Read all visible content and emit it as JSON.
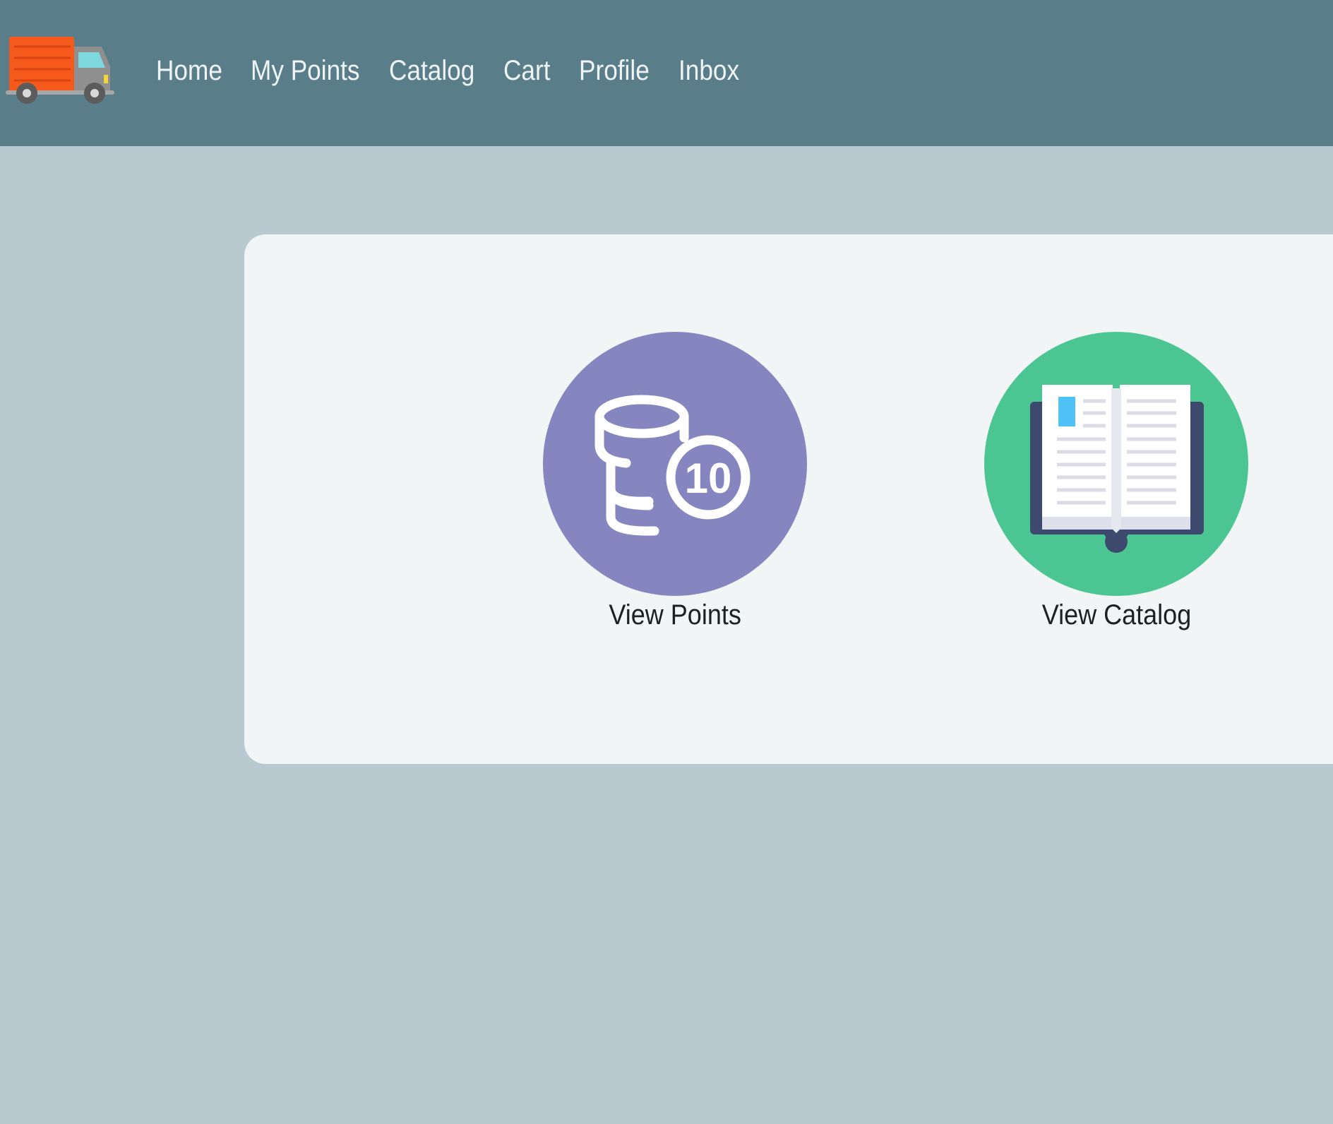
{
  "nav": {
    "logo_icon": "delivery-truck-icon",
    "links": [
      {
        "label": "Home"
      },
      {
        "label": "My Points"
      },
      {
        "label": "Catalog"
      },
      {
        "label": "Cart"
      },
      {
        "label": "Profile"
      },
      {
        "label": "Inbox"
      }
    ]
  },
  "tiles": [
    {
      "label": "View Points",
      "icon": "coins-icon",
      "icon_text": "10",
      "color": "#8585c0"
    },
    {
      "label": "View Catalog",
      "icon": "open-book-icon",
      "color": "#4bc692"
    }
  ],
  "colors": {
    "navbar": "#5a7e89",
    "page_background": "#b8c9d0",
    "card_background": "#f1f5f6"
  }
}
